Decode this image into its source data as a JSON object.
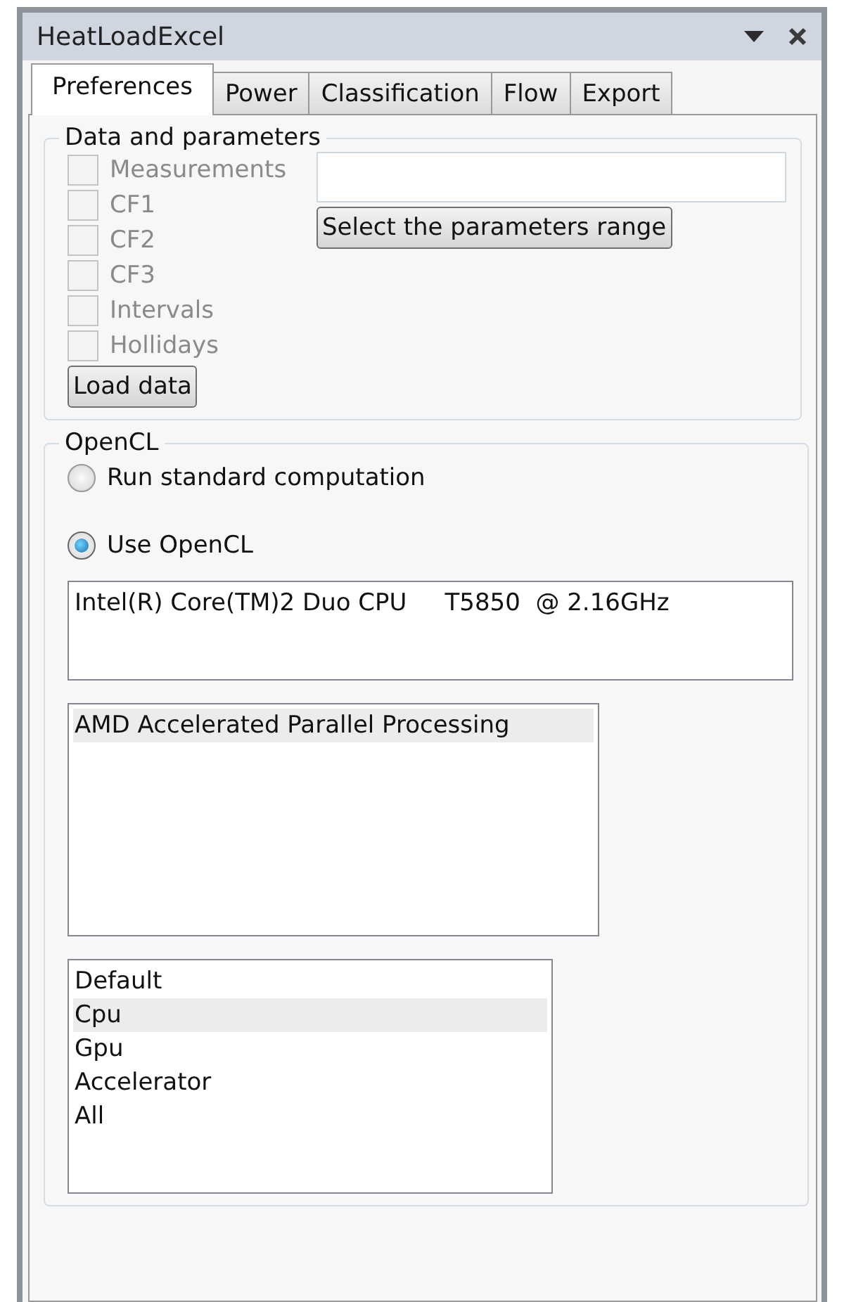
{
  "panel": {
    "title": "HeatLoadExcel"
  },
  "tabs": [
    {
      "label": "Preferences",
      "selected": true
    },
    {
      "label": "Power",
      "selected": false
    },
    {
      "label": "Classification",
      "selected": false
    },
    {
      "label": "Flow",
      "selected": false
    },
    {
      "label": "Export",
      "selected": false
    }
  ],
  "data_group": {
    "title": "Data and parameters",
    "checkboxes": [
      {
        "label": "Measurements",
        "checked": false,
        "disabled": true
      },
      {
        "label": "CF1",
        "checked": false,
        "disabled": true
      },
      {
        "label": "CF2",
        "checked": false,
        "disabled": true
      },
      {
        "label": "CF3",
        "checked": false,
        "disabled": true
      },
      {
        "label": "Intervals",
        "checked": false,
        "disabled": true
      },
      {
        "label": "Hollidays",
        "checked": false,
        "disabled": true
      }
    ],
    "range_button": "Select the parameters range",
    "load_button": "Load data"
  },
  "opencl_group": {
    "title": "OpenCL",
    "radios": [
      {
        "label": "Run standard computation",
        "selected": false
      },
      {
        "label": "Use OpenCL",
        "selected": true
      }
    ],
    "devices": [
      {
        "label": "Intel(R) Core(TM)2 Duo CPU     T5850  @ 2.16GHz",
        "selected": false
      }
    ],
    "platforms": [
      {
        "label": "AMD Accelerated Parallel Processing",
        "selected": true
      }
    ],
    "device_types": [
      {
        "label": "Default",
        "selected": false
      },
      {
        "label": "Cpu",
        "selected": true
      },
      {
        "label": "Gpu",
        "selected": false
      },
      {
        "label": "Accelerator",
        "selected": false
      },
      {
        "label": "All",
        "selected": false
      }
    ]
  }
}
